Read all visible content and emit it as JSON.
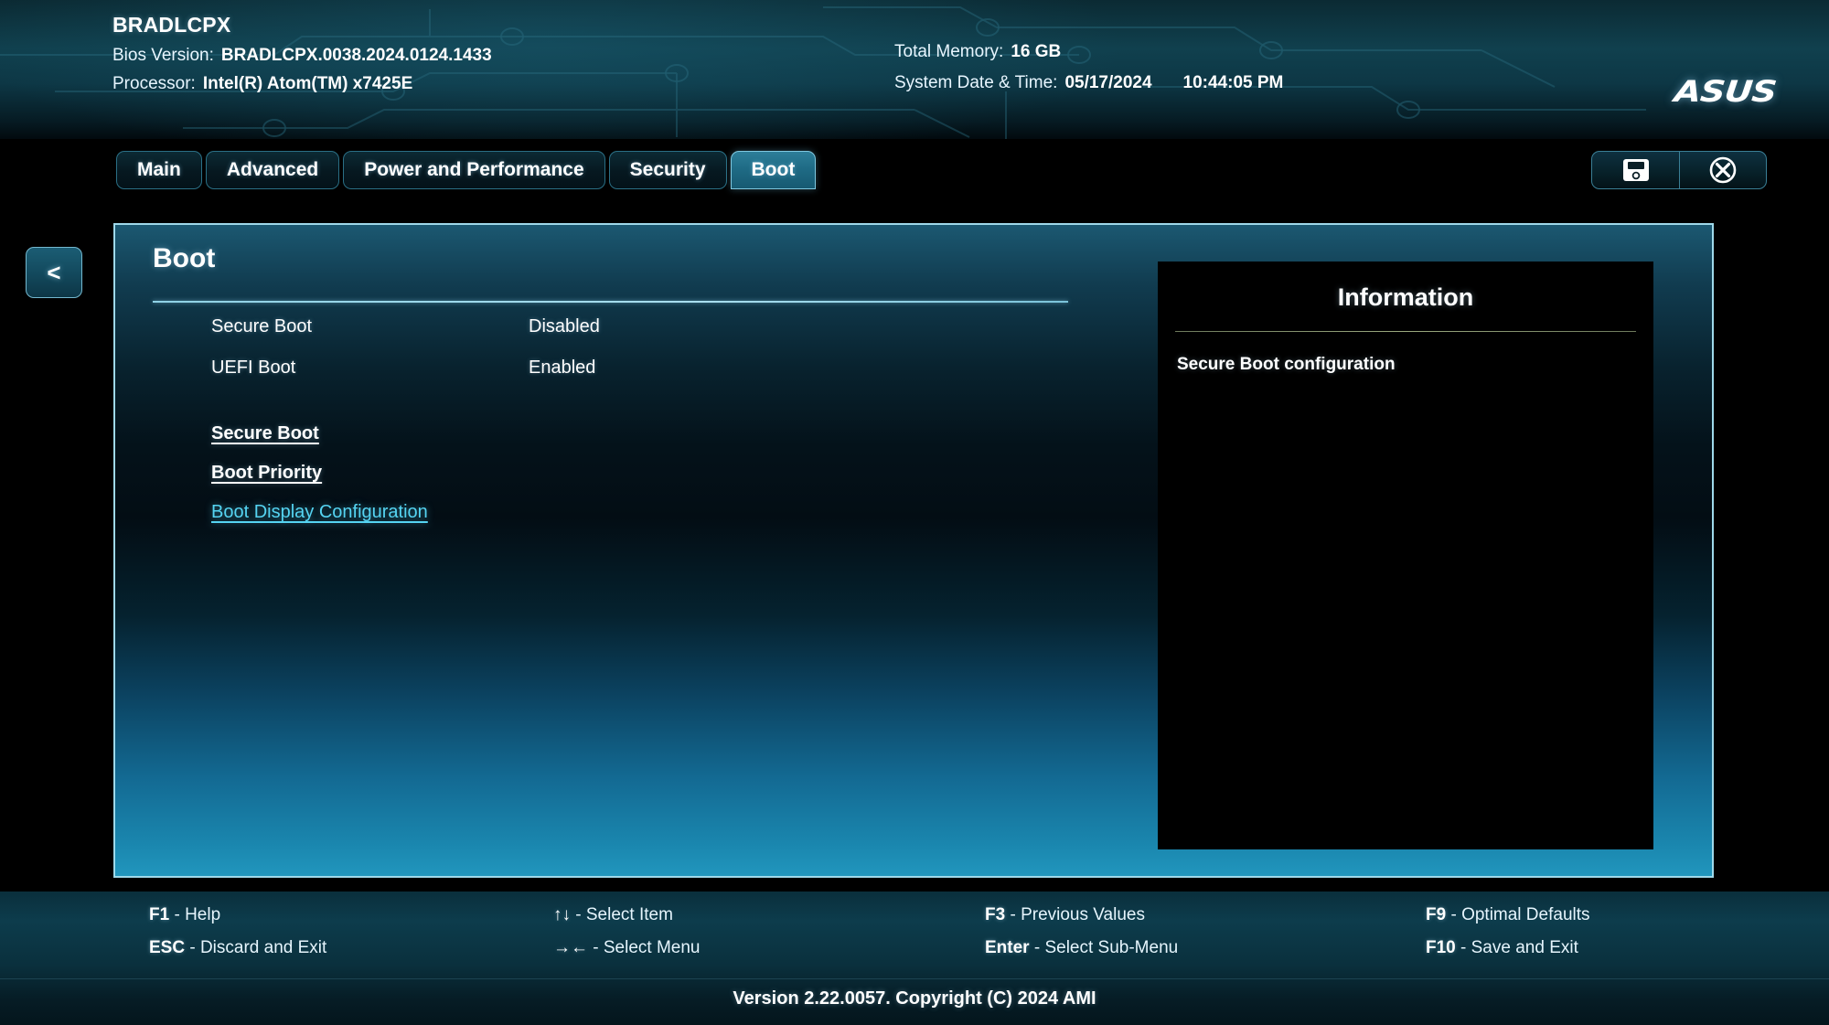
{
  "header": {
    "board_name": "BRADLCPX",
    "bios_version_label": "Bios Version:",
    "bios_version_value": "BRADLCPX.0038.2024.0124.1433",
    "processor_label": "Processor:",
    "processor_value": "Intel(R) Atom(TM) x7425E",
    "total_memory_label": "Total Memory:",
    "total_memory_value": "16 GB",
    "datetime_label": "System Date & Time:",
    "date_value": "05/17/2024",
    "time_value": "10:44:05 PM",
    "brand_logo": "ASUS"
  },
  "tabs": [
    {
      "label": "Main",
      "active": false
    },
    {
      "label": "Advanced",
      "active": false
    },
    {
      "label": "Power and Performance",
      "active": false
    },
    {
      "label": "Security",
      "active": false
    },
    {
      "label": "Boot",
      "active": true
    }
  ],
  "header_buttons": [
    {
      "name": "save-button",
      "icon": "floppy-disk-icon"
    },
    {
      "name": "exit-button",
      "icon": "close-circle-icon"
    }
  ],
  "back_button": {
    "label": "<"
  },
  "panel": {
    "title": "Boot",
    "settings": [
      {
        "label": "Secure Boot",
        "value": "Disabled"
      },
      {
        "label": "UEFI Boot",
        "value": "Enabled"
      }
    ],
    "submenus": [
      {
        "label": "Secure Boot",
        "style": "plain"
      },
      {
        "label": "Boot Priority",
        "style": "plain"
      },
      {
        "label": "Boot Display Configuration",
        "style": "highlight"
      }
    ]
  },
  "information": {
    "title": "Information",
    "body": "Secure Boot configuration"
  },
  "footer": {
    "hotkeys": [
      [
        {
          "key": "F1",
          "desc": " - Help"
        },
        {
          "key": "ESC",
          "desc": " - Discard and Exit"
        }
      ],
      [
        {
          "key": "↑↓",
          "desc": " - Select Item"
        },
        {
          "key": "→←",
          "desc": " - Select Menu"
        }
      ],
      [
        {
          "key": "F3",
          "desc": " - Previous Values"
        },
        {
          "key": "Enter",
          "desc": " - Select Sub-Menu"
        }
      ],
      [
        {
          "key": "F9",
          "desc": " - Optimal Defaults"
        },
        {
          "key": "F10",
          "desc": " - Save and Exit"
        }
      ]
    ],
    "version": "Version 2.22.0057. Copyright (C) 2024 AMI"
  },
  "colors": {
    "accent_cyan": "#55d4f2",
    "panel_border": "#9fd9ea",
    "active_tab": "#2d7e99",
    "header_bg": "#10404e"
  }
}
